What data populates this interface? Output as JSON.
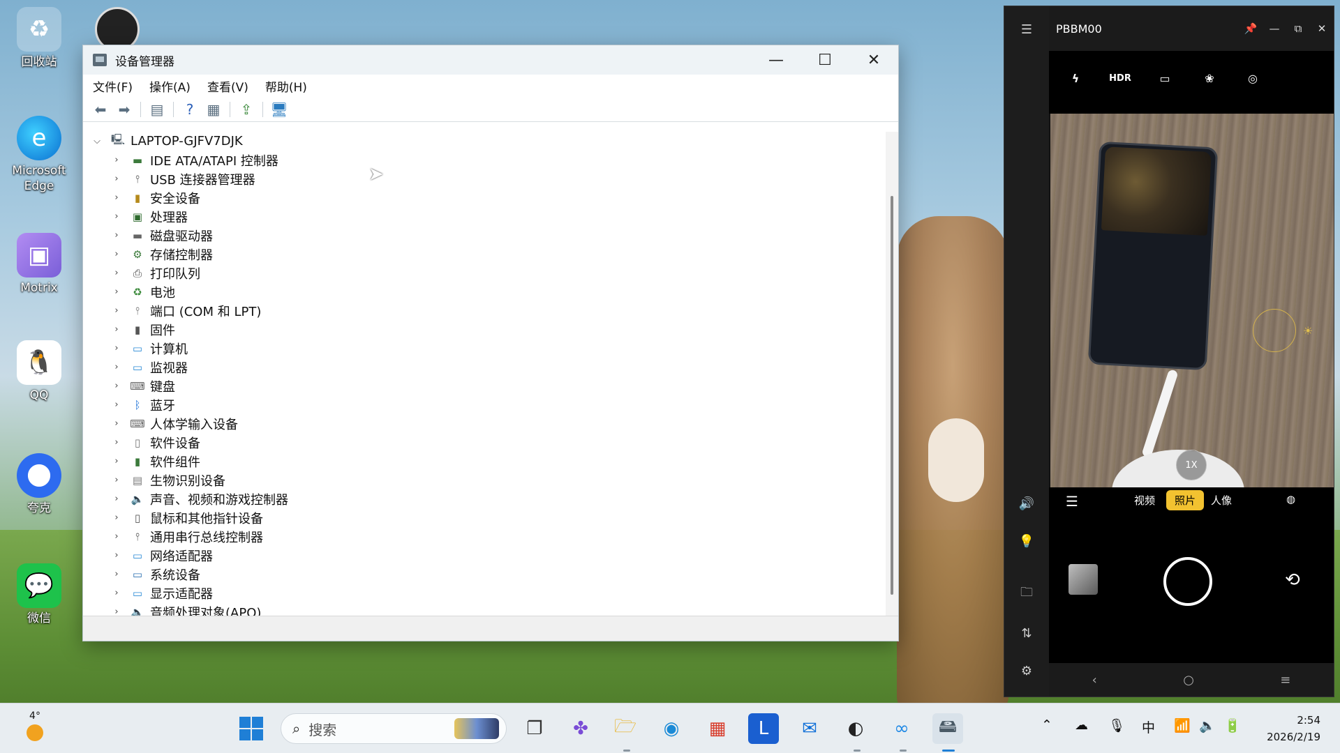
{
  "desktop": {
    "icons": [
      {
        "label": "回收站",
        "icon": "recycle-bin-icon"
      },
      {
        "label": "Microsoft Edge",
        "icon": "edge-icon"
      },
      {
        "label": "Motrix",
        "icon": "motrix-icon"
      },
      {
        "label": "QQ",
        "icon": "qq-icon"
      },
      {
        "label": "夸克",
        "icon": "quark-icon"
      },
      {
        "label": "微信",
        "icon": "wechat-icon"
      }
    ]
  },
  "device_manager": {
    "title": "设备管理器",
    "menu": [
      "文件(F)",
      "操作(A)",
      "查看(V)",
      "帮助(H)"
    ],
    "root": "LAPTOP-GJFV7DJK",
    "items": [
      {
        "label": "IDE ATA/ATAPI 控制器",
        "icon": "ide-controller-icon"
      },
      {
        "label": "USB 连接器管理器",
        "icon": "usb-icon"
      },
      {
        "label": "安全设备",
        "icon": "security-device-icon"
      },
      {
        "label": "处理器",
        "icon": "processor-icon"
      },
      {
        "label": "磁盘驱动器",
        "icon": "disk-drive-icon"
      },
      {
        "label": "存储控制器",
        "icon": "storage-controller-icon"
      },
      {
        "label": "打印队列",
        "icon": "printer-icon"
      },
      {
        "label": "电池",
        "icon": "battery-icon"
      },
      {
        "label": "端口 (COM 和 LPT)",
        "icon": "port-icon"
      },
      {
        "label": "固件",
        "icon": "firmware-icon"
      },
      {
        "label": "计算机",
        "icon": "computer-icon"
      },
      {
        "label": "监视器",
        "icon": "monitor-icon"
      },
      {
        "label": "键盘",
        "icon": "keyboard-icon"
      },
      {
        "label": "蓝牙",
        "icon": "bluetooth-icon"
      },
      {
        "label": "人体学输入设备",
        "icon": "hid-icon"
      },
      {
        "label": "软件设备",
        "icon": "software-device-icon"
      },
      {
        "label": "软件组件",
        "icon": "software-component-icon"
      },
      {
        "label": "生物识别设备",
        "icon": "biometric-icon"
      },
      {
        "label": "声音、视频和游戏控制器",
        "icon": "sound-icon"
      },
      {
        "label": "鼠标和其他指针设备",
        "icon": "mouse-icon"
      },
      {
        "label": "通用串行总线控制器",
        "icon": "usb-controller-icon"
      },
      {
        "label": "网络适配器",
        "icon": "network-adapter-icon"
      },
      {
        "label": "系统设备",
        "icon": "system-device-icon"
      },
      {
        "label": "显示适配器",
        "icon": "display-adapter-icon"
      },
      {
        "label": "音频处理对象(APO)",
        "icon": "audio-apo-icon"
      }
    ]
  },
  "phone": {
    "name": "PBBM00",
    "top_icons": [
      "flash-off-icon",
      "HDR",
      "aspect-icon",
      "filter-icon",
      "settings-icon"
    ],
    "zoom": "1X",
    "modes": [
      "视频",
      "照片",
      "人像"
    ],
    "selected_mode": "照片"
  },
  "taskbar": {
    "weather_temp": "4°",
    "search_placeholder": "搜索",
    "ime": "中",
    "time": "2:54",
    "date": "2026/2/19"
  },
  "colors": {
    "accent": "#1f7fd6",
    "camera_mode_selected": "#f2c230"
  }
}
